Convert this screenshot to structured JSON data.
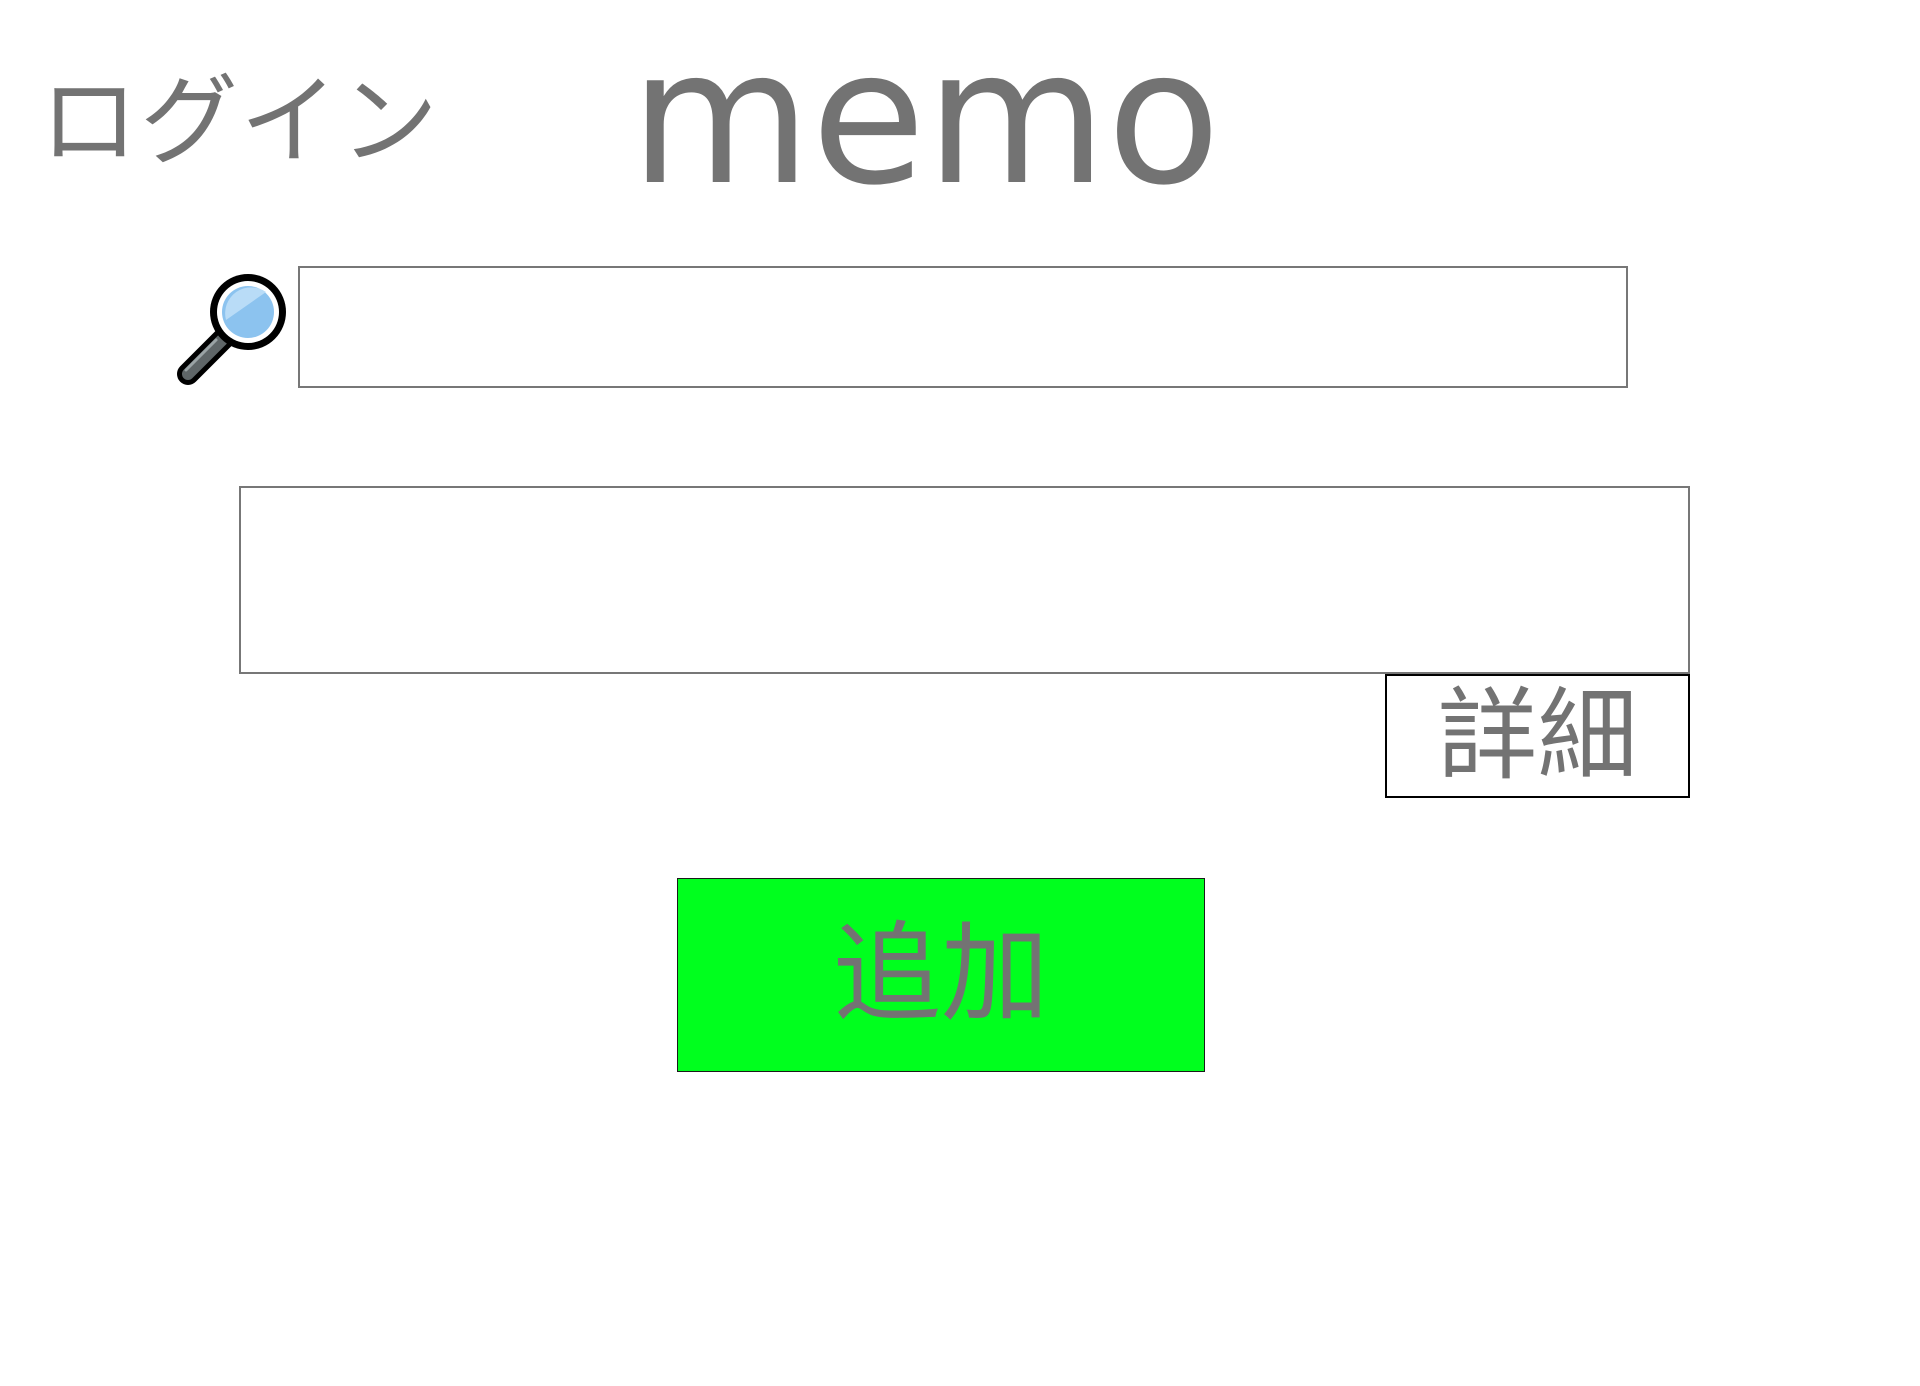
{
  "header": {
    "login_label": "ログイン",
    "title": "memo"
  },
  "search": {
    "icon": "magnifying-glass-icon",
    "value": "",
    "placeholder": ""
  },
  "memo_form": {
    "memo_value": "",
    "memo_placeholder": "",
    "detail_label": "詳細",
    "add_label": "追加"
  },
  "colors": {
    "text": "#737373",
    "add_button_bg": "#00ff1e",
    "input_border": "#777777",
    "detail_border": "#000000"
  }
}
